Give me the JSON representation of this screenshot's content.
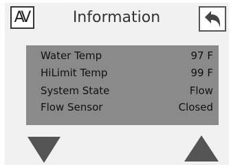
{
  "header": {
    "title": "Information",
    "av_label": "AV"
  },
  "info": {
    "rows": [
      {
        "label": "Water Temp",
        "value": "97 F"
      },
      {
        "label": "HiLimit Temp",
        "value": "99 F"
      },
      {
        "label": "System State",
        "value": "Flow"
      },
      {
        "label": "Flow Sensor",
        "value": "Closed"
      }
    ]
  },
  "colors": {
    "screen_bg": "#f1f1f1",
    "panel_bg": "#8a8a8a",
    "arrow": "#545454",
    "back_arrow": "#444444"
  },
  "icons": {
    "back": "back-arrow-icon",
    "down": "down-triangle-icon",
    "up": "up-triangle-icon",
    "av": "av-toggle-icon"
  }
}
